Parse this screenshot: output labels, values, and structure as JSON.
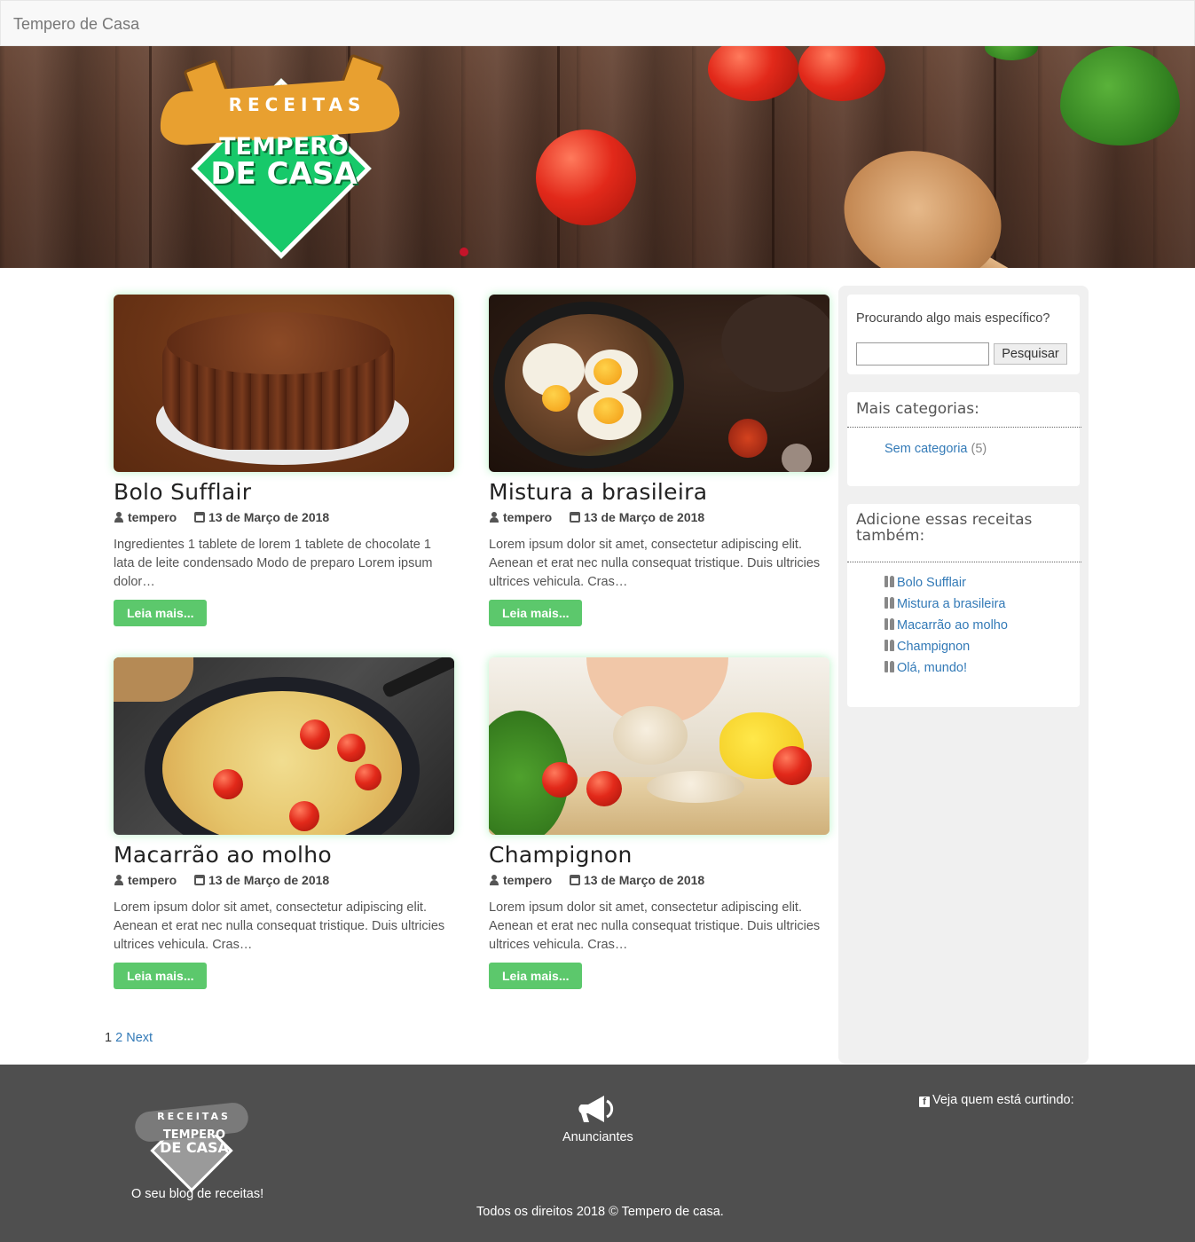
{
  "navbar": {
    "brand": "Tempero de Casa"
  },
  "hero": {
    "logo": {
      "line1": "RECEITAS",
      "line2": "TEMPERO",
      "line3": "DE CASA"
    }
  },
  "posts": [
    {
      "title": "Bolo Sufflair",
      "author": "tempero",
      "date": "13 de Março de 2018",
      "excerpt": "Ingredientes 1 tablete de lorem 1 tablete de chocolate 1 lata de leite condensado Modo de preparo Lorem ipsum dolor…",
      "button": "Leia mais..."
    },
    {
      "title": "Mistura a brasileira",
      "author": "tempero",
      "date": "13 de Março de 2018",
      "excerpt": "Lorem ipsum dolor sit amet, consectetur adipiscing elit. Aenean et erat nec nulla consequat tristique. Duis ultricies ultrices vehicula. Cras…",
      "button": "Leia mais..."
    },
    {
      "title": "Macarrão ao molho",
      "author": "tempero",
      "date": "13 de Março de 2018",
      "excerpt": "Lorem ipsum dolor sit amet, consectetur adipiscing elit. Aenean et erat nec nulla consequat tristique. Duis ultricies ultrices vehicula. Cras…",
      "button": "Leia mais..."
    },
    {
      "title": "Champignon",
      "author": "tempero",
      "date": "13 de Março de 2018",
      "excerpt": "Lorem ipsum dolor sit amet, consectetur adipiscing elit. Aenean et erat nec nulla consequat tristique. Duis ultricies ultrices vehicula. Cras…",
      "button": "Leia mais..."
    }
  ],
  "pagination": {
    "current": "1",
    "page2": "2",
    "next": "Next"
  },
  "sidebar": {
    "search": {
      "label": "Procurando algo mais específico?",
      "value": "",
      "button": "Pesquisar"
    },
    "categories": {
      "title": "Mais categorias:",
      "item": "Sem categoria",
      "count": "(5)"
    },
    "recipes": {
      "title": "Adicione essas receitas também:",
      "items": [
        "Bolo Sufflair",
        "Mistura a brasileira",
        "Macarrão ao molho",
        "Champignon",
        "Olá, mundo!"
      ]
    }
  },
  "footer": {
    "logo": {
      "line1": "RECEITAS",
      "line2": "TEMPERO",
      "line3": "DE CASA"
    },
    "tagline": "O seu blog de receitas!",
    "advertisers": "Anunciantes",
    "facebook": "Veja quem está curtindo:",
    "copyright": "Todos os direitos 2018 © Tempero de casa."
  },
  "colors": {
    "accent_button": "#5cc86c",
    "link": "#337ab7",
    "logo_green": "#17c96a",
    "logo_orange": "#e8a030",
    "footer_bg": "#4f4f4f"
  },
  "icons": [
    "user-icon",
    "calendar-icon",
    "fork-knife-icon",
    "megaphone-icon",
    "facebook-icon"
  ]
}
